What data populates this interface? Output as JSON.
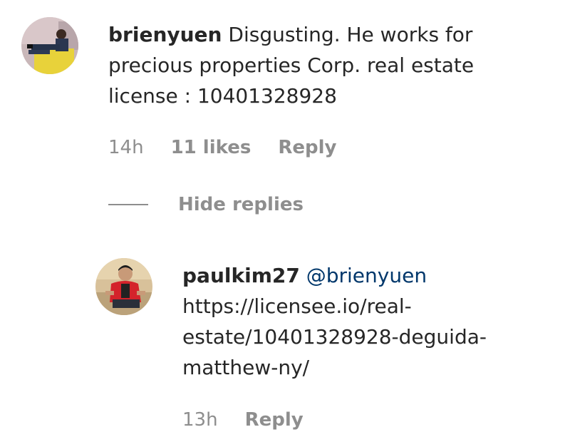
{
  "comments": [
    {
      "username": "brienyuen",
      "text": " Disgusting. He works for precious properties Corp. real estate license : 10401328928",
      "time": "14h",
      "likes": "11 likes",
      "reply_label": "Reply",
      "avatar_icon": "user-avatar-photo"
    }
  ],
  "hide_replies_label": "Hide replies",
  "replies": [
    {
      "username": "paulkim27",
      "mention": "@brienyuen",
      "link_line1": "https://licensee.io/real-",
      "link_line2": "estate/10401328928-deguida-",
      "link_line3": "matthew-ny/",
      "time": "13h",
      "reply_label": "Reply",
      "avatar_icon": "user-avatar-photo"
    }
  ],
  "colors": {
    "text": "#262626",
    "muted": "#8e8e8e",
    "mention": "#00376b"
  }
}
